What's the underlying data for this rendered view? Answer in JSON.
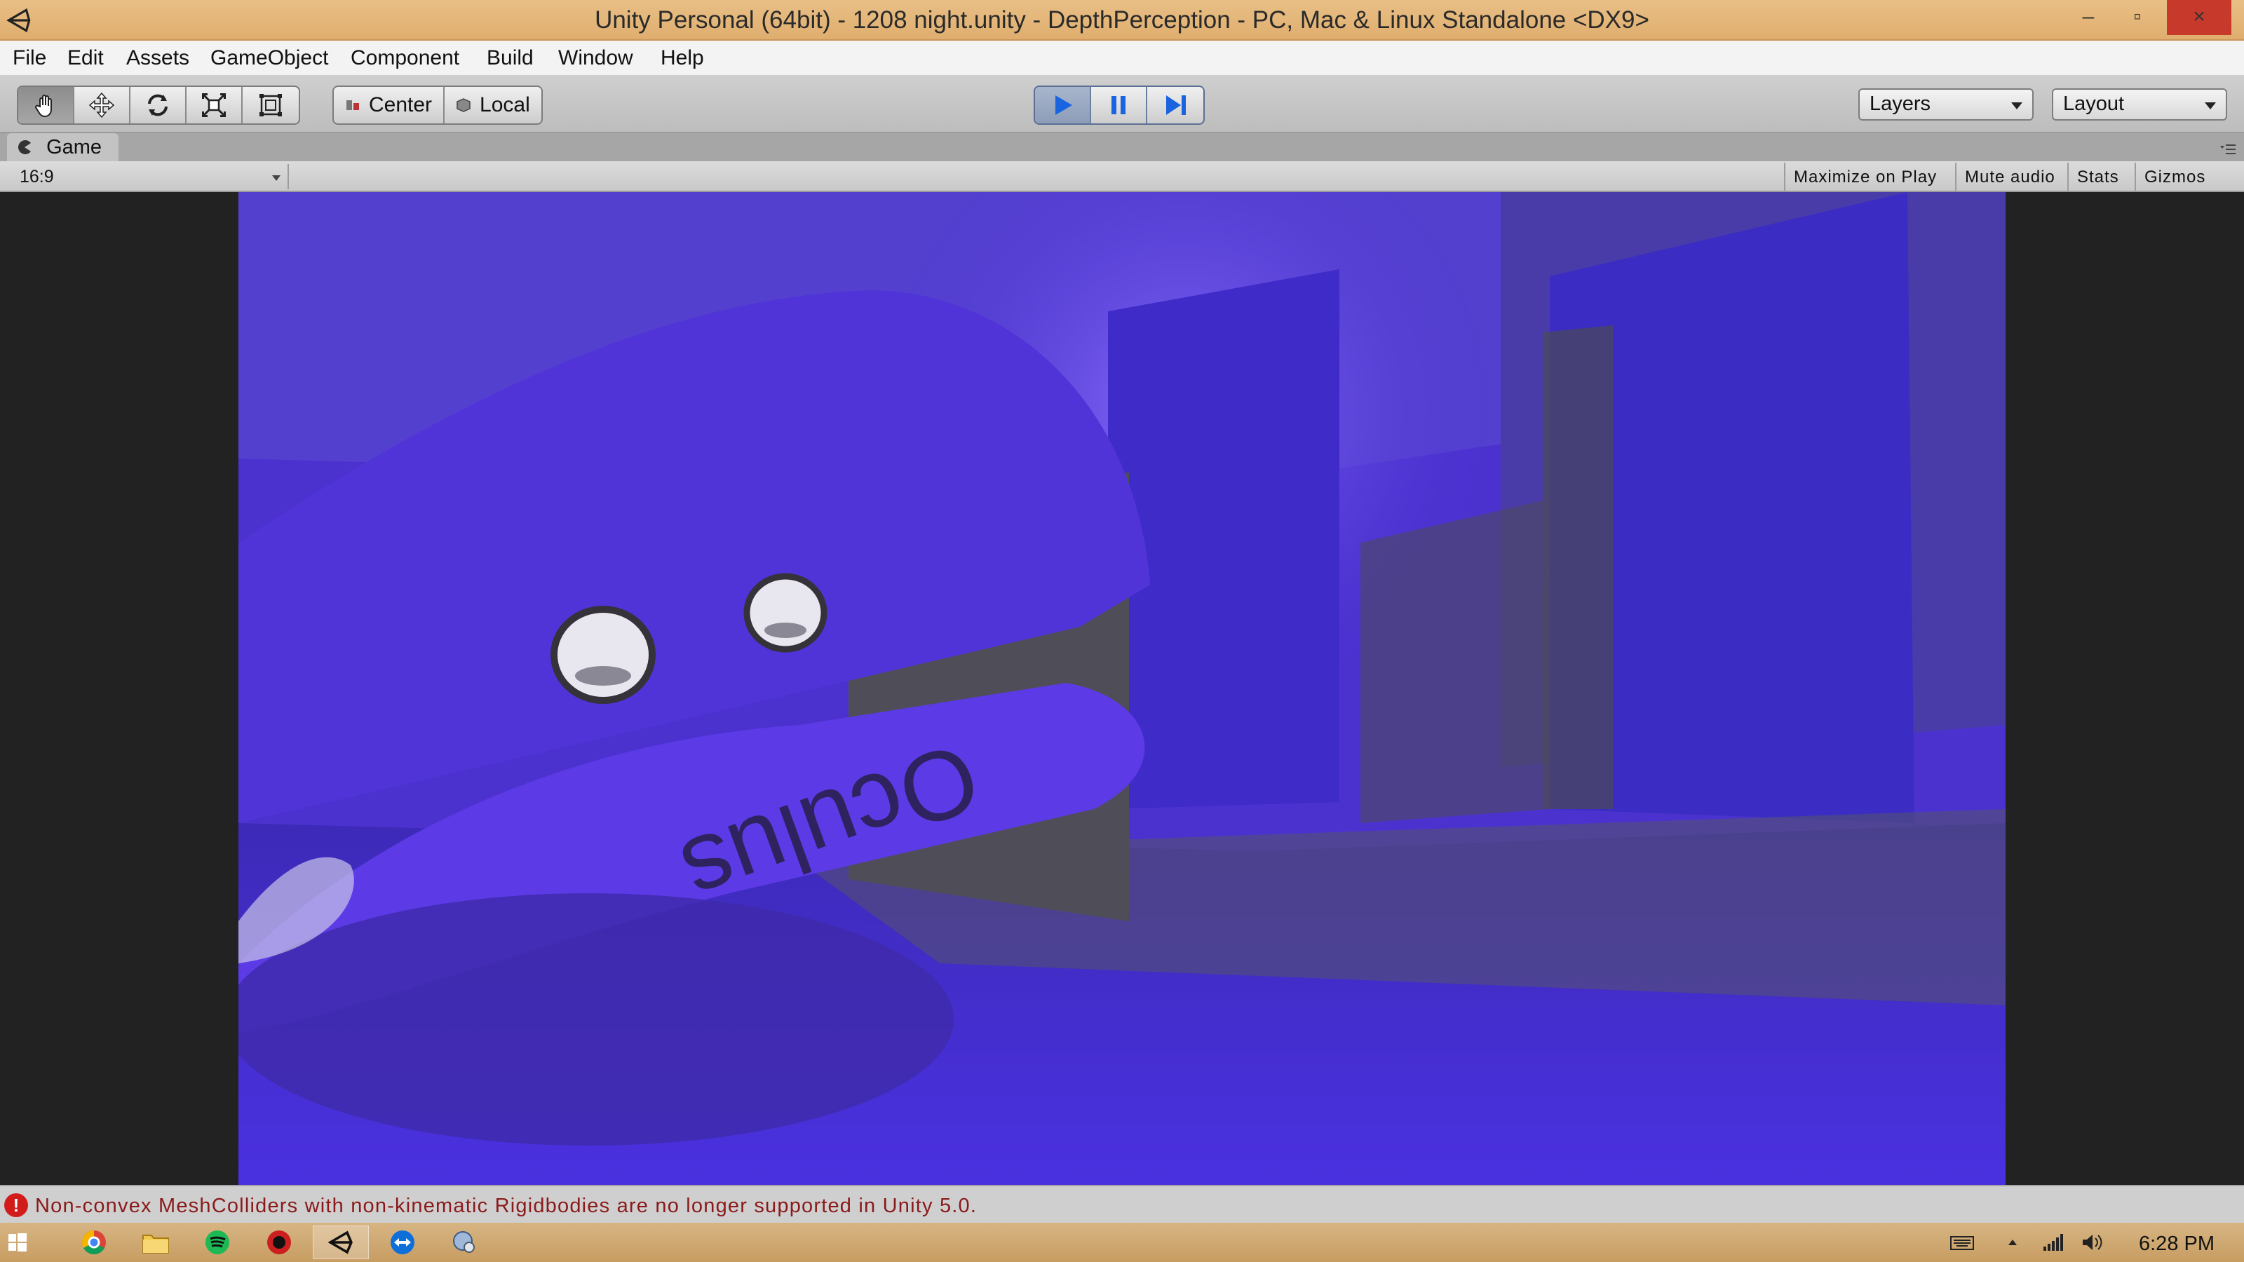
{
  "window": {
    "title": "Unity Personal (64bit) - 1208 night.unity - DepthPerception - PC, Mac & Linux Standalone <DX9>",
    "controls": {
      "minimize": "–",
      "restore": "▫",
      "close": "×"
    }
  },
  "menu": [
    "File",
    "Edit",
    "Assets",
    "GameObject",
    "Component",
    "Build",
    "Window",
    "Help"
  ],
  "toolbar": {
    "tools": [
      "hand-icon",
      "move-icon",
      "rotate-icon",
      "scale-icon",
      "rect-icon"
    ],
    "pivot_position": "Center",
    "pivot_rotation": "Local",
    "playmode": {
      "playing": true,
      "paused": false
    },
    "layers_label": "Layers",
    "layout_label": "Layout"
  },
  "game_panel": {
    "tab_label": "Game",
    "aspect": "16:9",
    "buttons": {
      "maximize": "Maximize on Play",
      "mute": "Mute audio",
      "stats": "Stats",
      "gizmos": "Gizmos"
    },
    "scene_text": "Oculus"
  },
  "console": {
    "message": "Non-convex MeshColliders with non-kinematic Rigidbodies are no longer supported in Unity 5.0."
  },
  "taskbar": {
    "apps": [
      "windows-start-icon",
      "chrome-icon",
      "file-explorer-icon",
      "spotify-icon",
      "record-app-icon",
      "unity-icon",
      "teamviewer-icon",
      "network-settings-icon"
    ],
    "clock": "6:28 PM"
  },
  "colors": {
    "scene_purple": "#4a2fd2",
    "accent_play": "#1a64e0",
    "error": "#d21c1c"
  }
}
